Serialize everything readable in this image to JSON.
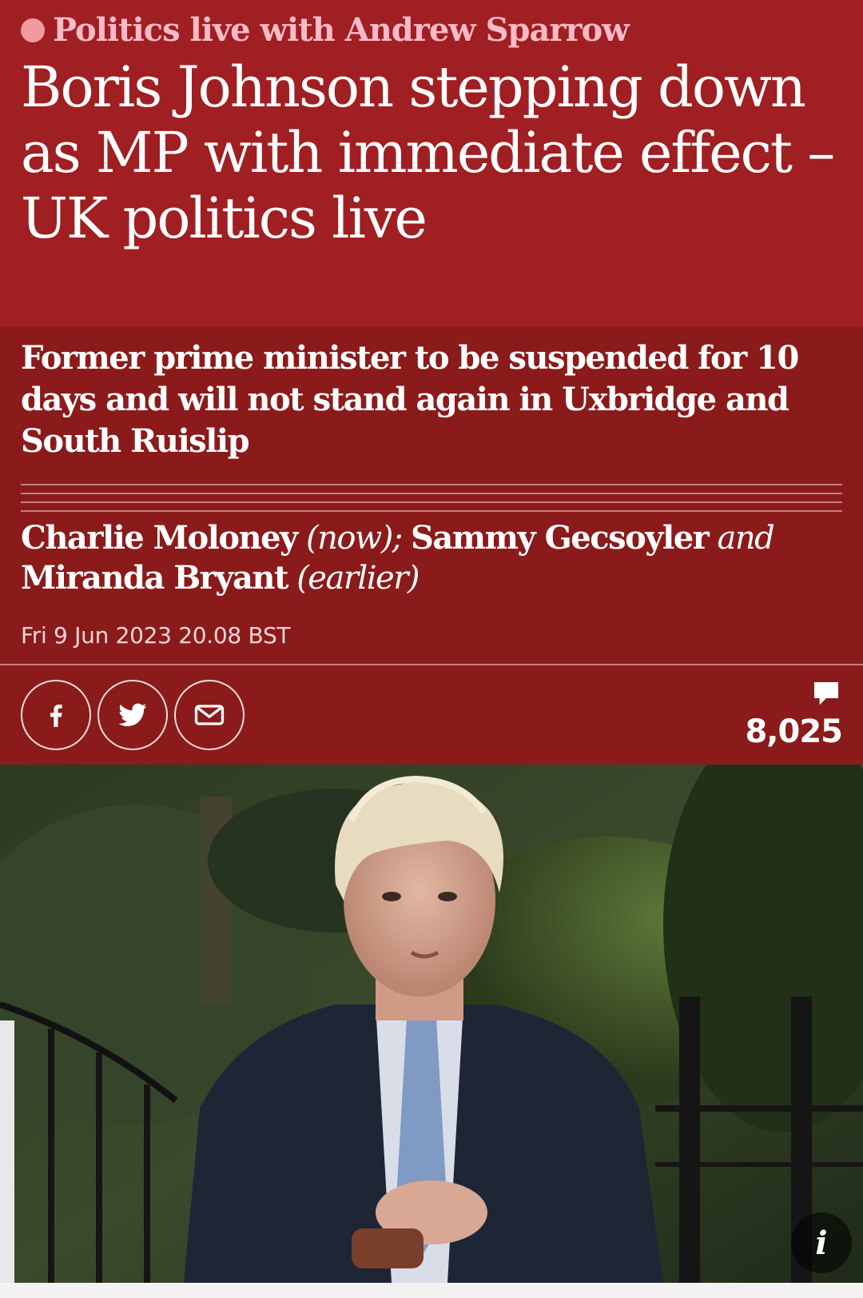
{
  "kicker": {
    "label": "Politics live with Andrew Sparrow",
    "live_dot_color": "#f39a9f"
  },
  "headline": {
    "line1": "Boris Johnson stepping down",
    "line2": "as MP with immediate effect –",
    "line3": "UK politics live"
  },
  "standfirst": "Former prime minister to be suspended for 10 days and will not stand again in Uxbridge and South Ruislip",
  "byline": {
    "author1": "Charlie Moloney",
    "author1_note": "(now);",
    "author2": "Sammy Gecsoyler",
    "conjunction": "and",
    "author3": "Miranda Bryant",
    "author3_note": "(earlier)"
  },
  "dateline": "Fri 9 Jun 2023 20.08 BST",
  "share": {
    "icons": [
      "facebook-icon",
      "twitter-icon",
      "email-icon"
    ]
  },
  "comments": {
    "icon": "speech-bubble-icon",
    "count": "8,025"
  },
  "photo": {
    "icon": "info-icon",
    "info_label": "i"
  },
  "colors": {
    "headline_bg": "#a01f22",
    "meta_bg": "#8b1b1b",
    "kicker_text": "#ffbac8"
  }
}
